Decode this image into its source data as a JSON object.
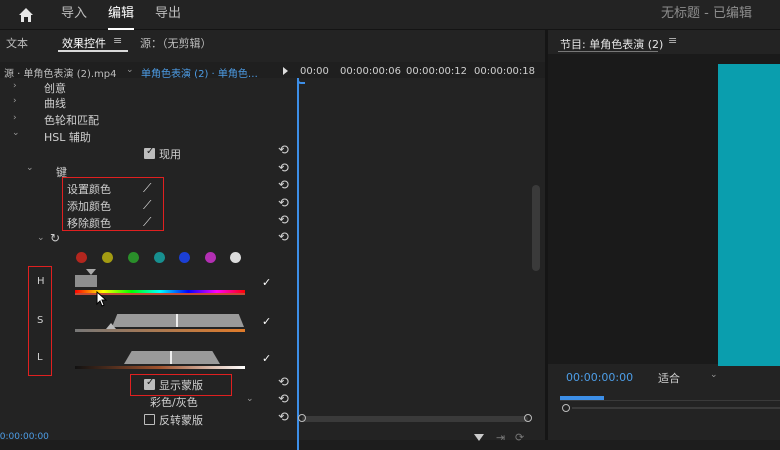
{
  "topbar": {
    "home_icon": "home-icon",
    "import": "导入",
    "edit": "编辑",
    "export": "导出",
    "title": "无标题 - 已编辑"
  },
  "left_tabs": {
    "text": "文本",
    "effect_controls": "效果控件",
    "source": "源：（无剪辑）"
  },
  "clip_bar": {
    "source_clip": "源 · 单角色表演 (2).mp4",
    "sequence_clip": "单角色表演 (2) · 单角色…"
  },
  "timeline": {
    "t0": "00:00",
    "t1": "00:00:00:06",
    "t2": "00:00:00:12",
    "t3": "00:00:00:18"
  },
  "tree": {
    "creative": "创意",
    "curves": "曲线",
    "color_wheels": "色轮和匹配",
    "hsl": "HSL 辅助",
    "enable": "现用",
    "key": "键",
    "set_color": "设置颜色",
    "add_color": "添加颜色",
    "remove_color": "移除颜色"
  },
  "hsl_labels": {
    "h": "H",
    "s": "S",
    "l": "L"
  },
  "swatches": [
    "#b3261e",
    "#a39b12",
    "#2a8f2a",
    "#178f8f",
    "#1b3fd6",
    "#b32fb3",
    "#dcdcdc"
  ],
  "mask": {
    "show": "显示蒙版",
    "mode": "彩色/灰色",
    "invert": "反转蒙版"
  },
  "footer": {
    "timecode": "00:00:00:00"
  },
  "program": {
    "title": "节目: 单角色表演 (2)",
    "menu_icon": "hamburger-icon",
    "timecode": "00:00:00:00",
    "fit": "适合",
    "video_color": "#0a9eae"
  }
}
